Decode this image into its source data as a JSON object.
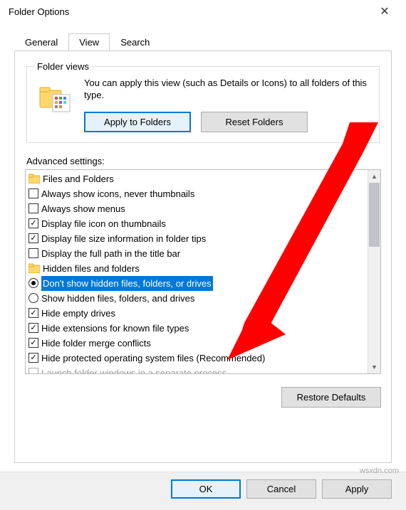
{
  "window": {
    "title": "Folder Options"
  },
  "tabs": {
    "general": "General",
    "view": "View",
    "search": "Search"
  },
  "folder_views": {
    "legend": "Folder views",
    "description": "You can apply this view (such as Details or Icons) to all folders of this type.",
    "apply_btn": "Apply to Folders",
    "reset_btn": "Reset Folders"
  },
  "advanced": {
    "label": "Advanced settings:",
    "items": [
      {
        "type": "folder",
        "level": 0,
        "text": "Files and Folders"
      },
      {
        "type": "check",
        "checked": false,
        "level": 1,
        "text": "Always show icons, never thumbnails"
      },
      {
        "type": "check",
        "checked": false,
        "level": 1,
        "text": "Always show menus"
      },
      {
        "type": "check",
        "checked": true,
        "level": 1,
        "text": "Display file icon on thumbnails"
      },
      {
        "type": "check",
        "checked": true,
        "level": 1,
        "text": "Display file size information in folder tips"
      },
      {
        "type": "check",
        "checked": false,
        "level": 1,
        "text": "Display the full path in the title bar"
      },
      {
        "type": "folder",
        "level": 1,
        "text": "Hidden files and folders"
      },
      {
        "type": "radio",
        "selected": true,
        "level": 2,
        "highlighted": true,
        "text": "Don't show hidden files, folders, or drives"
      },
      {
        "type": "radio",
        "selected": false,
        "level": 2,
        "text": "Show hidden files, folders, and drives"
      },
      {
        "type": "check",
        "checked": true,
        "level": 1,
        "text": "Hide empty drives"
      },
      {
        "type": "check",
        "checked": true,
        "level": 1,
        "text": "Hide extensions for known file types"
      },
      {
        "type": "check",
        "checked": true,
        "level": 1,
        "text": "Hide folder merge conflicts"
      },
      {
        "type": "check",
        "checked": true,
        "level": 1,
        "text": "Hide protected operating system files (Recommended)"
      }
    ],
    "cutoff": "Launch folder windows in a separate process"
  },
  "restore_btn": "Restore Defaults",
  "bottom": {
    "ok": "OK",
    "cancel": "Cancel",
    "apply": "Apply"
  },
  "watermark": "wsxdn.com",
  "colors": {
    "accent": "#0078d7",
    "arrow": "#ff0000"
  }
}
